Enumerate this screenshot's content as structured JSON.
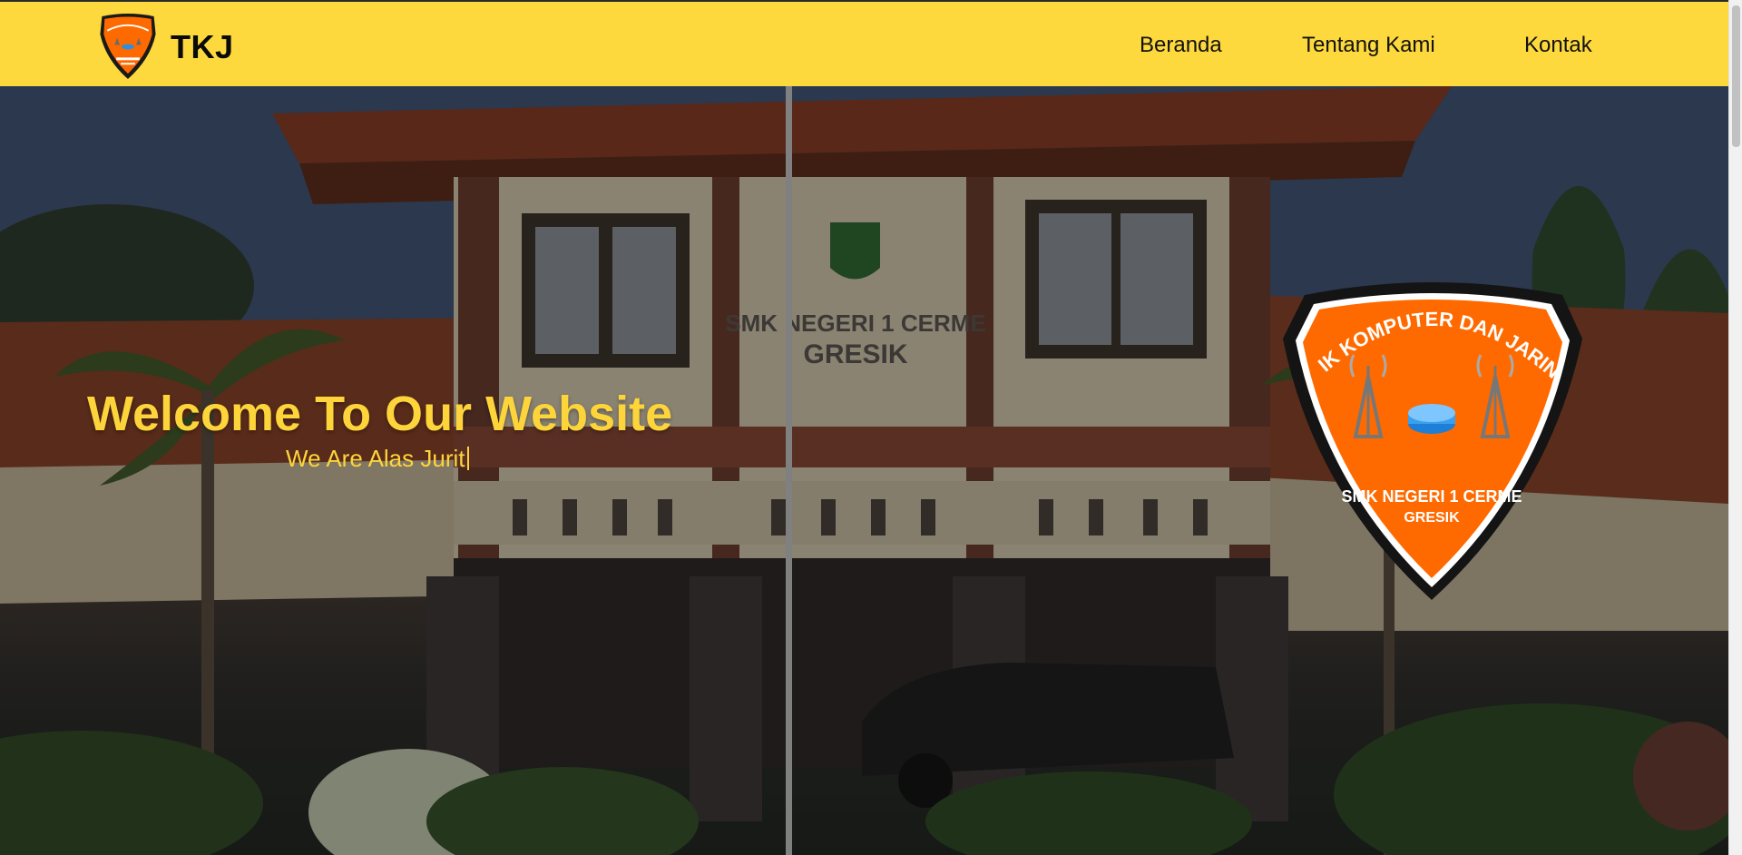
{
  "brand": {
    "name": "TKJ"
  },
  "nav": {
    "beranda": "Beranda",
    "tentang": "Tentang Kami",
    "kontak": "Kontak"
  },
  "hero": {
    "title": "Welcome To Our Website",
    "subtitle": "We Are Alas Jurit",
    "building_sign_line1": "SMK NEGERI 1 CERME",
    "building_sign_line2": "GRESIK"
  },
  "emblem": {
    "arc_text": "TEKNIK KOMPUTER DAN JARINGAN",
    "school": "SMK NEGERI 1 CERME",
    "city": "GRESIK"
  },
  "colors": {
    "navbar": "#fdd93d",
    "accent_yellow": "#fdd53a",
    "emblem_orange": "#ff6a00"
  },
  "icons": [
    "tkj-logo-icon",
    "antenna-tower-icon",
    "router-icon",
    "scrollbar"
  ]
}
